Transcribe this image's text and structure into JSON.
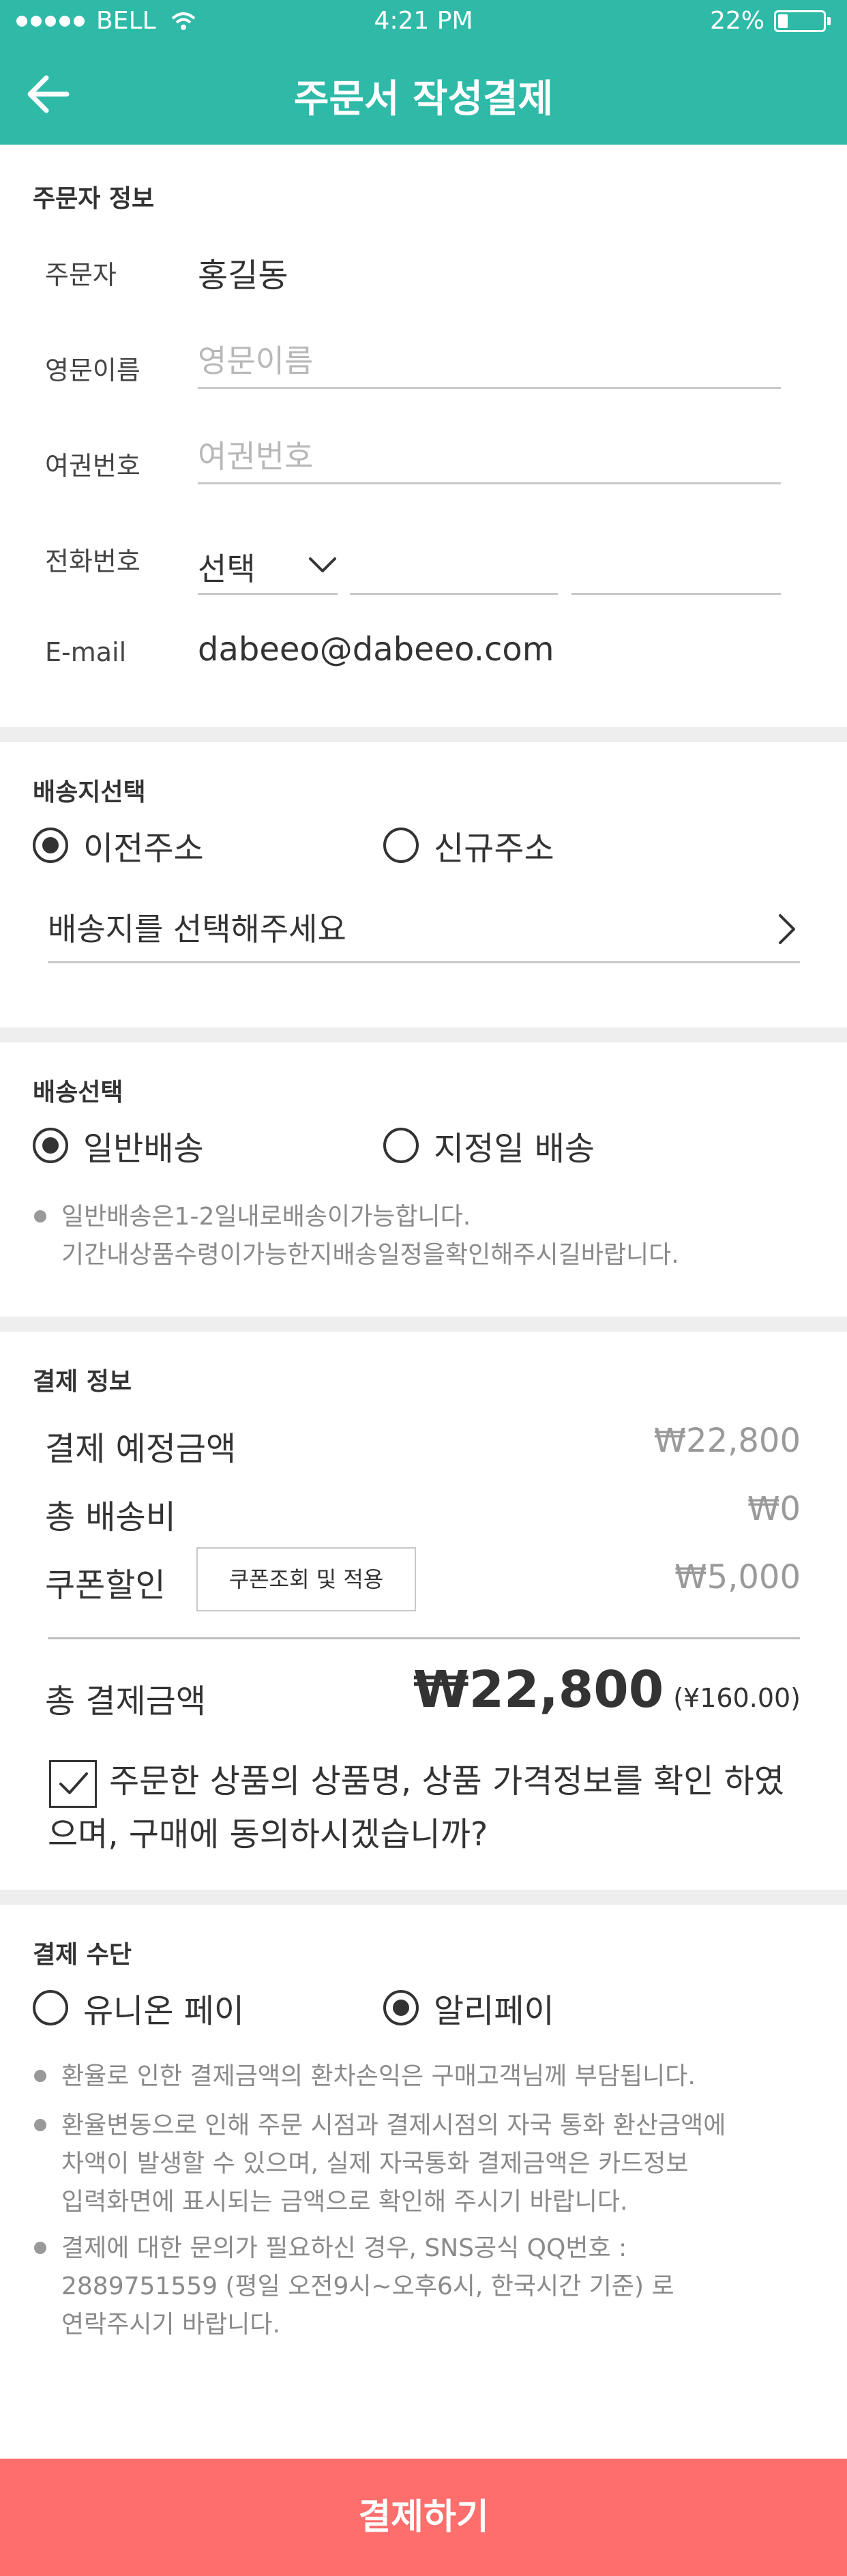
{
  "status_bar": {
    "carrier": "BELL",
    "time": "4:21 PM",
    "battery_text": "22%",
    "battery_level_percent": 22
  },
  "header": {
    "title": "주문서 작성결제",
    "back_icon": "back-arrow-icon"
  },
  "orderer_info": {
    "section_title": "주문자 정보",
    "orderer_label": "주문자",
    "orderer_value": "홍길동",
    "english_name_label": "영문이름",
    "english_name_placeholder": "영문이름",
    "passport_label": "여권번호",
    "passport_placeholder": "여권번호",
    "phone_label": "전화번호",
    "phone_select_value": "선택",
    "email_label": "E-mail",
    "email_value": "dabeeo@dabeeo.com"
  },
  "address": {
    "section_title": "배송지선택",
    "options": [
      {
        "label": "이전주소",
        "selected": true
      },
      {
        "label": "신규주소",
        "selected": false
      }
    ],
    "select_prompt": "배송지를 선택해주세요"
  },
  "delivery": {
    "section_title": "배송선택",
    "options": [
      {
        "label": "일반배송",
        "selected": true
      },
      {
        "label": "지정일 배송",
        "selected": false
      }
    ],
    "note": "일반배송은1-2일내로배송이가능합니다.\n기간내상품수령이가능한지배송일정을확인해주시길바랍니다."
  },
  "payment_info": {
    "section_title": "결제 정보",
    "expected_label": "결제 예정금액",
    "expected_value": "₩22,800",
    "shipping_label": "총 배송비",
    "shipping_value": "₩0",
    "coupon_label": "쿠폰할인",
    "coupon_button": "쿠폰조회 및 적용",
    "coupon_value": "₩5,000",
    "total_label": "총 결제금액",
    "total_value": "₩22,800",
    "total_sub": "(¥160.00)",
    "agree_line1": "주문한 상품의 상품명, 상품 가격정보를 확인 하였",
    "agree_line2": "으며, 구매에 동의하시겠습니까?",
    "agree_checked": true
  },
  "payment_method": {
    "section_title": "결제 수단",
    "options": [
      {
        "label": "유니온 페이",
        "selected": false
      },
      {
        "label": "알리페이",
        "selected": true
      }
    ],
    "notes": [
      "환율로 인한 결제금액의 환차손익은 구매고객님께 부담됩니다.",
      "환율변동으로 인해 주문 시점과 결제시점의 자국 통화 환산금액에\n차액이 발생할 수 있으며, 실제 자국통화 결제금액은 카드정보\n입력화면에 표시되는 금액으로 확인해 주시기 바랍니다.",
      "결제에 대한 문의가 필요하신 경우, SNS공식 QQ번호 :\n2889751559 (평일 오전9시~오후6시, 한국시간 기준) 로\n연락주시기 바랍니다."
    ]
  },
  "pay_button": "결제하기",
  "colors": {
    "header": "#2fbaa8",
    "pay_button": "#fd6e6c",
    "divider": "#eeeeee"
  }
}
